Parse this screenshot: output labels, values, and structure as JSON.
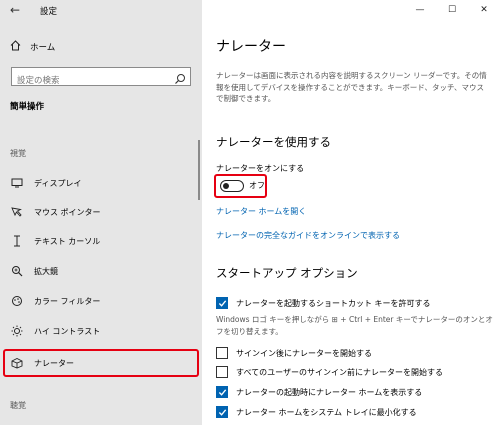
{
  "app": {
    "title": "設定"
  },
  "sidebar": {
    "home_label": "ホーム",
    "search_placeholder": "設定の検索",
    "section_title": "簡単操作",
    "group_vision": "視覚",
    "group_hearing": "聴覚",
    "items": [
      {
        "label": "ディスプレイ",
        "icon": "display-icon"
      },
      {
        "label": "マウス ポインター",
        "icon": "mouse-pointer-icon"
      },
      {
        "label": "テキスト カーソル",
        "icon": "text-cursor-icon"
      },
      {
        "label": "拡大鏡",
        "icon": "magnifier-icon"
      },
      {
        "label": "カラー フィルター",
        "icon": "color-filter-icon"
      },
      {
        "label": "ハイ コントラスト",
        "icon": "high-contrast-icon"
      },
      {
        "label": "ナレーター",
        "icon": "narrator-icon",
        "selected": true
      }
    ]
  },
  "window_controls": {
    "minimize": "—",
    "maximize": "☐",
    "close": "✕"
  },
  "main": {
    "title": "ナレーター",
    "description": "ナレーターは画面に表示される内容を説明するスクリーン リーダーです。その情報を使用してデバイスを操作することができます。キーボード、タッチ、マウスで制御できます。",
    "use_heading": "ナレーターを使用する",
    "toggle_label": "ナレーターをオンにする",
    "toggle_state": "オフ",
    "toggle_on": false,
    "link_home": "ナレーター ホームを開く",
    "link_guide": "ナレーターの完全なガイドをオンラインで表示する",
    "startup_heading": "スタートアップ オプション",
    "options": [
      {
        "label": "ナレーターを起動するショートカット キーを許可する",
        "checked": true
      },
      {
        "label": "サインイン後にナレーターを開始する",
        "checked": false
      },
      {
        "label": "すべてのユーザーのサインイン前にナレーターを開始する",
        "checked": false
      },
      {
        "label": "ナレーターの起動時にナレーター ホームを表示する",
        "checked": true
      },
      {
        "label": "ナレーター ホームをシステム トレイに最小化する",
        "checked": true
      }
    ],
    "shortcut_hint": "Windows ロゴ キーを押しながら ⊞ + Ctrl + Enter キーでナレーターのオンとオフを切り替えます。"
  },
  "colors": {
    "accent": "#0063b1",
    "highlight": "#e60012",
    "sidebar_bg": "#e6e6e6"
  }
}
